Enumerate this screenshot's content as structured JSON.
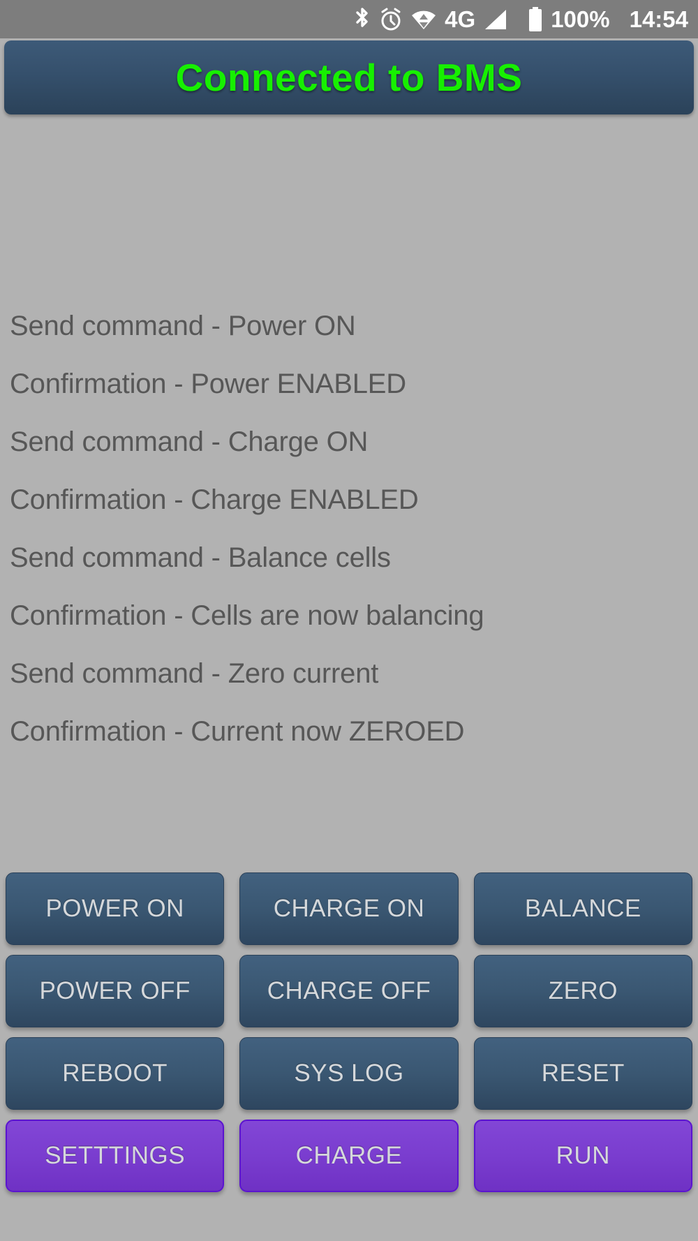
{
  "status_bar": {
    "icons": [
      {
        "name": "bluetooth-icon",
        "label": "Bluetooth"
      },
      {
        "name": "alarm-clock-icon",
        "label": "Alarm"
      },
      {
        "name": "wifi-data-transfer-icon",
        "label": "Wi-Fi data"
      }
    ],
    "network_type": "4G",
    "signal_icon": "signal-strength-icon",
    "battery_icon": "battery-full-icon",
    "battery_percent": "100%",
    "clock": "14:54"
  },
  "title_bar": {
    "title": "Connected to BMS",
    "title_color": "#17f000",
    "background_color": "#35506c"
  },
  "log": {
    "lines": [
      "Send command - Power ON",
      "Confirmation - Power ENABLED",
      "Send command - Charge ON",
      "Confirmation - Charge ENABLED",
      "Send command - Balance cells",
      "Confirmation - Cells are now balancing",
      "Send command - Zero current",
      "Confirmation - Current now ZEROED"
    ]
  },
  "buttons": {
    "rows": [
      {
        "style": "blue",
        "items": [
          {
            "label": "POWER ON",
            "name": "power-on-button"
          },
          {
            "label": "CHARGE ON",
            "name": "charge-on-button"
          },
          {
            "label": "BALANCE",
            "name": "balance-button"
          }
        ]
      },
      {
        "style": "blue",
        "items": [
          {
            "label": "POWER OFF",
            "name": "power-off-button"
          },
          {
            "label": "CHARGE OFF",
            "name": "charge-off-button"
          },
          {
            "label": "ZERO",
            "name": "zero-button"
          }
        ]
      },
      {
        "style": "blue",
        "items": [
          {
            "label": "REBOOT",
            "name": "reboot-button"
          },
          {
            "label": "SYS LOG",
            "name": "sys-log-button"
          },
          {
            "label": "RESET",
            "name": "reset-button"
          }
        ]
      },
      {
        "style": "purple",
        "items": [
          {
            "label": "SETTTINGS",
            "name": "settings-button"
          },
          {
            "label": "CHARGE",
            "name": "charge-button"
          },
          {
            "label": "RUN",
            "name": "run-button"
          }
        ]
      }
    ]
  },
  "colors": {
    "page_background": "#b2b2b2",
    "status_bar_background": "#7d7d7d",
    "blue_button": "#3a5772",
    "purple_button": "#7a3dcf",
    "log_text": "#575757"
  }
}
